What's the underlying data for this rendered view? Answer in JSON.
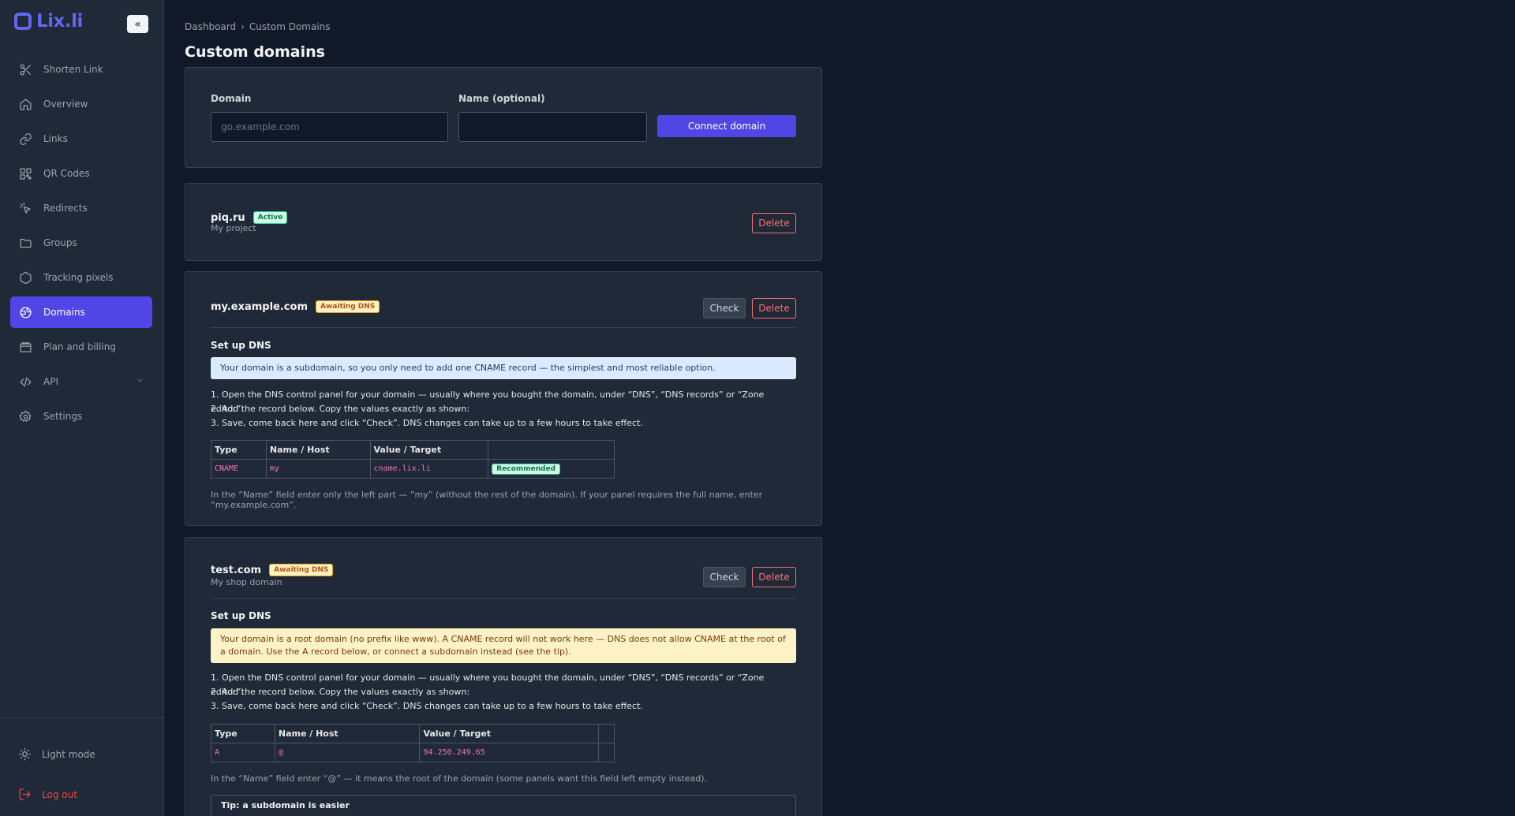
{
  "brand": {
    "name": "Lix.li"
  },
  "sidebar": {
    "collapse_label": "«",
    "items": [
      {
        "label": "Shorten Link",
        "icon": "scissors-icon",
        "active": false
      },
      {
        "label": "Overview",
        "icon": "home-icon",
        "active": false
      },
      {
        "label": "Links",
        "icon": "link-icon",
        "active": false
      },
      {
        "label": "QR Codes",
        "icon": "qr-code-icon",
        "active": false
      },
      {
        "label": "Redirects",
        "icon": "cursor-click-icon",
        "active": false
      },
      {
        "label": "Groups",
        "icon": "folder-icon",
        "active": false
      },
      {
        "label": "Tracking pixels",
        "icon": "hexagon-icon",
        "active": false
      },
      {
        "label": "Domains",
        "icon": "globe-icon",
        "active": true
      },
      {
        "label": "Plan and billing",
        "icon": "wallet-icon",
        "active": false
      },
      {
        "label": "API",
        "icon": "code-icon",
        "active": false,
        "expandable": true
      },
      {
        "label": "Settings",
        "icon": "gear-icon",
        "active": false
      }
    ],
    "light_mode_label": "Light mode",
    "logout_label": "Log out"
  },
  "breadcrumb": {
    "root": "Dashboard",
    "separator": "›",
    "current": "Custom Domains"
  },
  "page_title": "Custom domains",
  "form": {
    "domain_label": "Domain",
    "domain_placeholder": "go.example.com",
    "domain_value": "",
    "name_label": "Name (optional)",
    "name_value": "",
    "submit_label": "Connect domain"
  },
  "domains": [
    {
      "name": "piq.ru",
      "status": "Active",
      "description": "My project",
      "delete_label": "Delete"
    },
    {
      "name": "my.example.com",
      "status": "Awaiting DNS",
      "check_label": "Check",
      "delete_label": "Delete",
      "setup_title": "Set up DNS",
      "notice": "Your domain is a subdomain, so you only need to add one CNAME record — the simplest and most reliable option.",
      "steps": [
        "1. Open the DNS control panel for your domain — usually where you bought the domain, under “DNS”, “DNS records” or “Zone editor”.",
        "2. Add the record below. Copy the values exactly as shown:",
        "3. Save, come back here and click “Check”. DNS changes can take up to a few hours to take effect."
      ],
      "table": {
        "headers": [
          "Type",
          "Name / Host",
          "Value / Target",
          ""
        ],
        "rows": [
          {
            "type": "CNAME",
            "host": "my",
            "value": "cname.lix.li",
            "badge": "Recommended"
          }
        ]
      },
      "note": "In the “Name” field enter only the left part — “my” (without the rest of the domain). If your panel requires the full name, enter “my.example.com”."
    },
    {
      "name": "test.com",
      "status": "Awaiting DNS",
      "description": "My shop domain",
      "check_label": "Check",
      "delete_label": "Delete",
      "setup_title": "Set up DNS",
      "notice": "Your domain is a root domain (no prefix like www). A CNAME record will not work here — DNS does not allow CNAME at the root of a domain. Use the A record below, or connect a subdomain instead (see the tip).",
      "steps": [
        "1. Open the DNS control panel for your domain — usually where you bought the domain, under “DNS”, “DNS records” or “Zone editor”.",
        "2. Add the record below. Copy the values exactly as shown:",
        "3. Save, come back here and click “Check”. DNS changes can take up to a few hours to take effect."
      ],
      "table": {
        "headers": [
          "Type",
          "Name / Host",
          "Value / Target",
          ""
        ],
        "rows": [
          {
            "type": "A",
            "host": "@",
            "value": "94.250.249.65",
            "badge": ""
          }
        ]
      },
      "note": "In the “Name” field enter “@” — it means the root of the domain (some panels want this field left empty instead).",
      "tip_title": "Tip: a subdomain is easier"
    }
  ]
}
